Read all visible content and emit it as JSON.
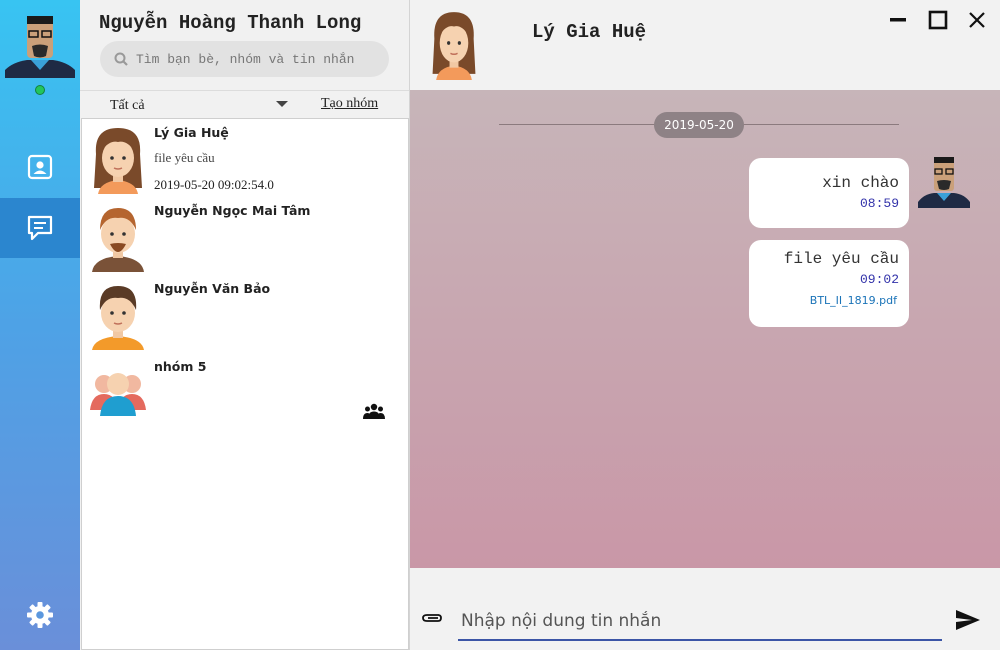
{
  "user": {
    "name": "Nguyễn Hoàng Thanh Long",
    "status": "online"
  },
  "search": {
    "placeholder": "Tìm bạn bè, nhóm và tin nhắn"
  },
  "filter": {
    "selected": "Tất cả",
    "create_group_label": "Tạo nhóm"
  },
  "nav": {
    "items": [
      "contacts-icon",
      "messages-icon",
      "settings-icon"
    ],
    "active": "messages-icon"
  },
  "contacts": [
    {
      "name": "Lý Gia Huệ",
      "last_message": "file yêu cầu",
      "time": "2019-05-20 09:02:54.0"
    },
    {
      "name": "Nguyễn Ngọc Mai Tâm"
    },
    {
      "name": "Nguyễn Văn Bảo"
    },
    {
      "name": "nhóm 5",
      "is_group": true
    }
  ],
  "chat": {
    "peer_name": "Lý Gia Huệ",
    "date_separator": "2019-05-20",
    "messages": [
      {
        "text": "xin chào",
        "time": "08:59"
      },
      {
        "text": "file yêu cầu",
        "time": "09:02",
        "attachment": "BTL_II_1819.pdf"
      }
    ]
  },
  "composer": {
    "placeholder": "Nhập nội dung tin nhắn"
  },
  "colors": {
    "rail_top": "#38c4f2",
    "rail_bottom": "#6a8fd9",
    "rail_active": "#2b86cf",
    "chat_bg_top": "#c7b5b9",
    "chat_bg_bottom": "#c997a7",
    "online": "#22c55e",
    "input_underline": "#3b55a6",
    "date_badge": "#8e8286"
  }
}
